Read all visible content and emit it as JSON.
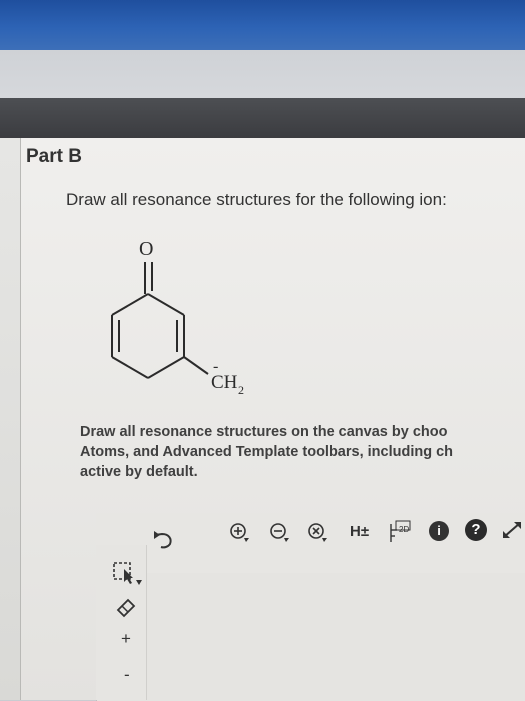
{
  "header": {
    "part_label": "Part B"
  },
  "question": {
    "prompt": "Draw all resonance structures for the following ion:",
    "molecule": {
      "oxygen_label": "O",
      "carbanion_label": "CH",
      "carbanion_subscript": "2",
      "charge": "-"
    }
  },
  "instructions": {
    "line1": "Draw all resonance structures on the canvas by choo",
    "line2": "Atoms, and Advanced Template toolbars, including ch",
    "line3": "active by default."
  },
  "toolbar": {
    "hydrogen_label": "H±",
    "view_2d_label": "2D",
    "info_symbol": "i",
    "help_symbol": "?",
    "add_symbol": "+",
    "minus_symbol": "-"
  }
}
